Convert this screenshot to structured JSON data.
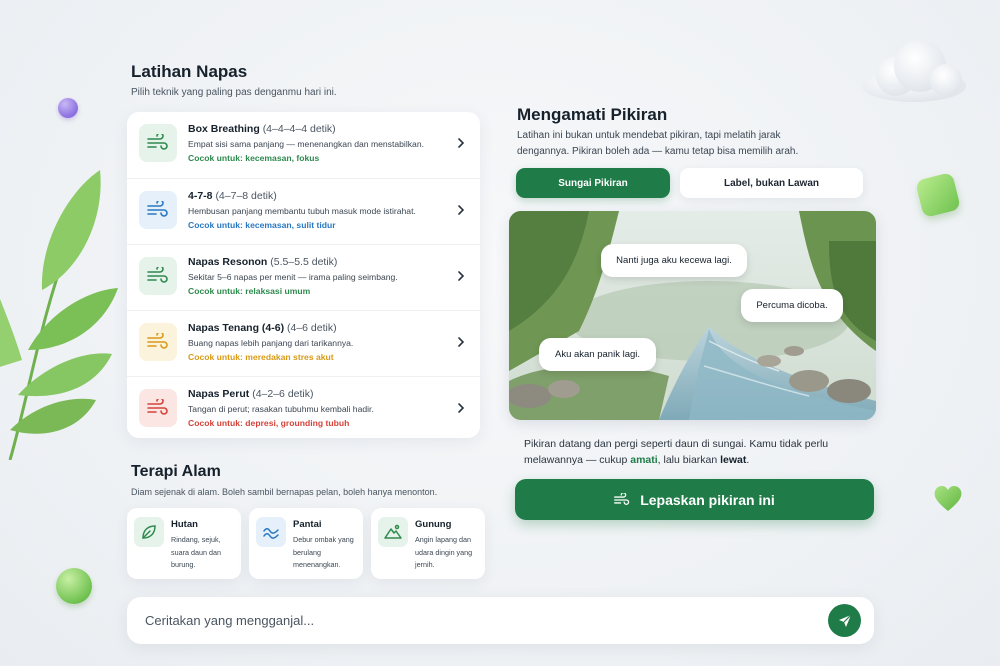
{
  "breathing": {
    "title": "Latihan Napas",
    "subtitle": "Pilih teknik yang paling pas denganmu hari ini.",
    "items": [
      {
        "name": "Box Breathing",
        "timing": "(4–4–4–4 detik)",
        "desc": "Empat sisi sama panjang — menenangkan dan menstabilkan.",
        "fit": "Cocok untuk: kecemasan, fokus",
        "color": "#2f8a4e",
        "bg": "#e6f3ea"
      },
      {
        "name": "4-7-8",
        "timing": "(4–7–8 detik)",
        "desc": "Hembusan panjang membantu tubuh masuk mode istirahat.",
        "fit": "Cocok untuk: kecemasan, sulit tidur",
        "color": "#2a78c2",
        "bg": "#e5f0fa"
      },
      {
        "name": "Napas Resonon",
        "timing": "(5.5–5.5 detik)",
        "desc": "Sekitar 5–6 napas per menit — irama paling seimbang.",
        "fit": "Cocok untuk: relaksasi umum",
        "color": "#2f8a4e",
        "bg": "#e6f3ea"
      },
      {
        "name": "Napas Tenang (4-6)",
        "timing": "(4–6 detik)",
        "desc": "Buang napas lebih panjang dari tarikannya.",
        "fit": "Cocok untuk: meredakan stres akut",
        "color": "#d89a17",
        "bg": "#fcf3dd"
      },
      {
        "name": "Napas Perut",
        "timing": "(4–2–6 detik)",
        "desc": "Tangan di perut; rasakan tubuhmu kembali hadir.",
        "fit": "Cocok untuk: depresi, grounding tubuh",
        "color": "#d4423a",
        "bg": "#fbe6e4"
      }
    ]
  },
  "nature": {
    "title": "Terapi Alam",
    "subtitle": "Diam sejenak di alam. Boleh sambil bernapas pelan, boleh hanya menonton.",
    "items": [
      {
        "name": "Hutan",
        "desc": "Rindang, sejuk, suara daun dan burung.",
        "icon": "leaf-icon"
      },
      {
        "name": "Pantai",
        "desc": "Debur ombak yang berulang menenangkan.",
        "icon": "wave-icon"
      },
      {
        "name": "Gunung",
        "desc": "Angin lapang dan udara dingin yang jernih.",
        "icon": "mountain-icon"
      }
    ]
  },
  "thoughts": {
    "title": "Mengamati Pikiran",
    "desc": "Latihan ini bukan untuk mendebat pikiran, tapi melatih jarak dengannya. Pikiran boleh ada — kamu tetap bisa memilih arah.",
    "tabs": [
      "Sungai Pikiran",
      "Label, bukan Lawan"
    ],
    "active_tab": "Sungai Pikiran",
    "bubbles": [
      "Nanti juga aku kecewa lagi.",
      "Percuma dicoba.",
      "Aku akan panik lagi."
    ],
    "note_pre": "Pikiran datang dan pergi seperti daun di sungai. Kamu tidak perlu melawannya — cukup ",
    "note_b1": "amati",
    "note_mid": ", lalu biarkan ",
    "note_b2": "lewat",
    "note_end": ".",
    "release_label": "Lepaskan pikiran ini"
  },
  "chat": {
    "placeholder": "Ceritakan yang mengganjal..."
  },
  "colors": {
    "accent": "#1f7c48"
  }
}
